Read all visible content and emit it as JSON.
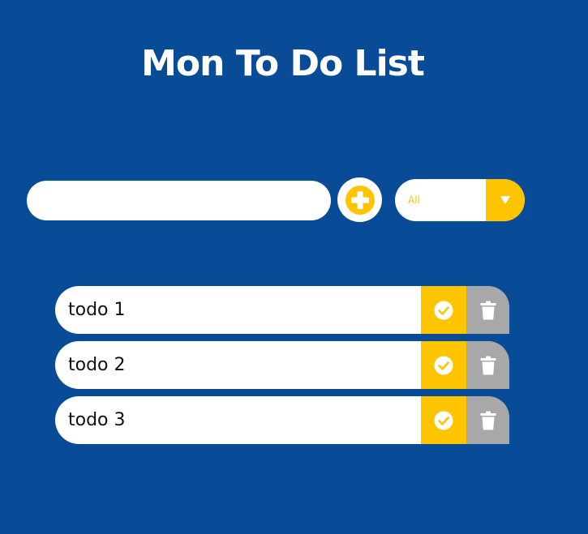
{
  "header": {
    "title": "Mon To Do List"
  },
  "form": {
    "input_value": "",
    "input_placeholder": "",
    "add_icon": "plus-circle-icon",
    "filter_selected": "All",
    "filter_icon": "caret-down-icon"
  },
  "todos": [
    {
      "text": "todo 1"
    },
    {
      "text": "todo 2"
    },
    {
      "text": "todo 3"
    }
  ],
  "icons": {
    "complete": "check-circle-icon",
    "delete": "trash-icon"
  },
  "colors": {
    "background": "#084b96",
    "accent": "#ffc400",
    "delete": "#a8a8a8",
    "surface": "#ffffff"
  }
}
